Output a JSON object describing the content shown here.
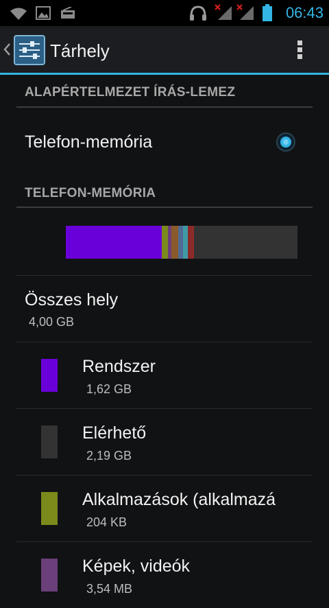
{
  "status_bar": {
    "time": "06:43",
    "icons": [
      "wifi-icon",
      "image-icon",
      "radio-icon",
      "headset-icon",
      "signal-no-service-icon",
      "signal-no-service-icon",
      "battery-icon"
    ]
  },
  "action_bar": {
    "title": "Tárhely",
    "back_icon": "chevron-left-icon",
    "app_icon": "settings-sliders-icon",
    "menu_icon": "overflow-menu-icon"
  },
  "default_write_disk": {
    "header": "ALAPÉRTELMEZET ÍRÁS-LEMEZ",
    "option_label": "Telefon-memória",
    "selected": true
  },
  "phone_memory": {
    "header": "TELEFON-MEMÓRIA",
    "usage_bar": [
      {
        "name": "Rendszer",
        "fraction": 0.405,
        "color": "#6a00d9"
      },
      {
        "name": "Alkalmazások",
        "fraction": 0.026,
        "color": "#7c8a1c"
      },
      {
        "name": "Képek, videók",
        "fraction": 0.014,
        "color": "#6b3f7a"
      },
      {
        "name": "segment-4",
        "fraction": 0.03,
        "color": "#8a5a2a"
      },
      {
        "name": "segment-5",
        "fraction": 0.022,
        "color": "#4f6b93"
      },
      {
        "name": "segment-6",
        "fraction": 0.02,
        "color": "#3f9aa6"
      },
      {
        "name": "segment-7",
        "fraction": 0.025,
        "color": "#8c2a2a"
      },
      {
        "name": "Elérhető",
        "fraction": 0.438,
        "color": "#333333"
      }
    ],
    "total": {
      "label": "Összes hely",
      "value": "4,00 GB"
    },
    "items": [
      {
        "label": "Rendszer",
        "value": "1,62 GB",
        "color": "#6a00d9"
      },
      {
        "label": "Elérhető",
        "value": "2,19 GB",
        "color": "#333333"
      },
      {
        "label": "Alkalmazások (alkalmazá",
        "value": "204 KB",
        "color": "#7c8a1c"
      },
      {
        "label": "Képek, videók",
        "value": "3,54 MB",
        "color": "#6b3f7a"
      }
    ]
  }
}
